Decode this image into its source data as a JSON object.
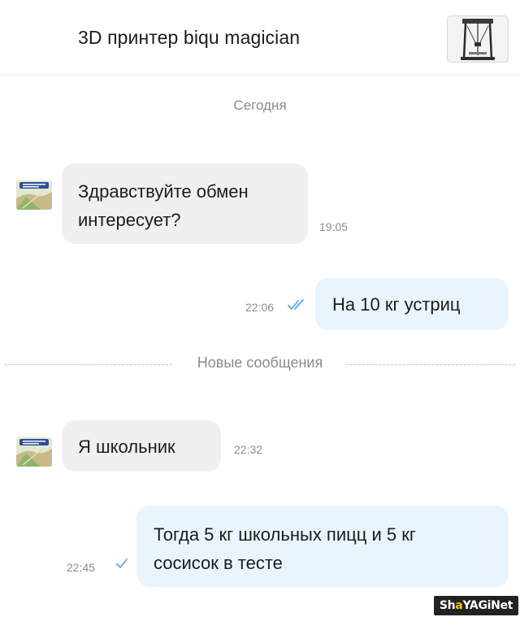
{
  "header": {
    "title": "3D принтер biqu magician",
    "product_icon": "delta-3d-printer-thumbnail"
  },
  "date_separator": "Сегодня",
  "new_messages_label": "Новые сообщения",
  "messages": [
    {
      "direction": "incoming",
      "lines": [
        "Здравствуйте обмен",
        "интересует?"
      ],
      "time": "19:05"
    },
    {
      "direction": "outgoing",
      "lines": [
        "На 10 кг устриц"
      ],
      "time": "22:06",
      "status": "read-double-check"
    },
    {
      "direction": "incoming",
      "lines": [
        "Я школьник"
      ],
      "time": "22:32"
    },
    {
      "direction": "outgoing",
      "lines": [
        "Тогда 5 кг школьных пицц и 5 кг",
        "сосисок в тесте"
      ],
      "time": "22:45",
      "status": "sent-single-check"
    }
  ],
  "colors": {
    "incoming_bubble": "#f0f0f0",
    "outgoing_bubble": "#e9f4fd",
    "check_mark": "#5aa9e6"
  },
  "watermark": {
    "part1": "Sh",
    "part2": "YAGiNet",
    "accent": "a"
  }
}
